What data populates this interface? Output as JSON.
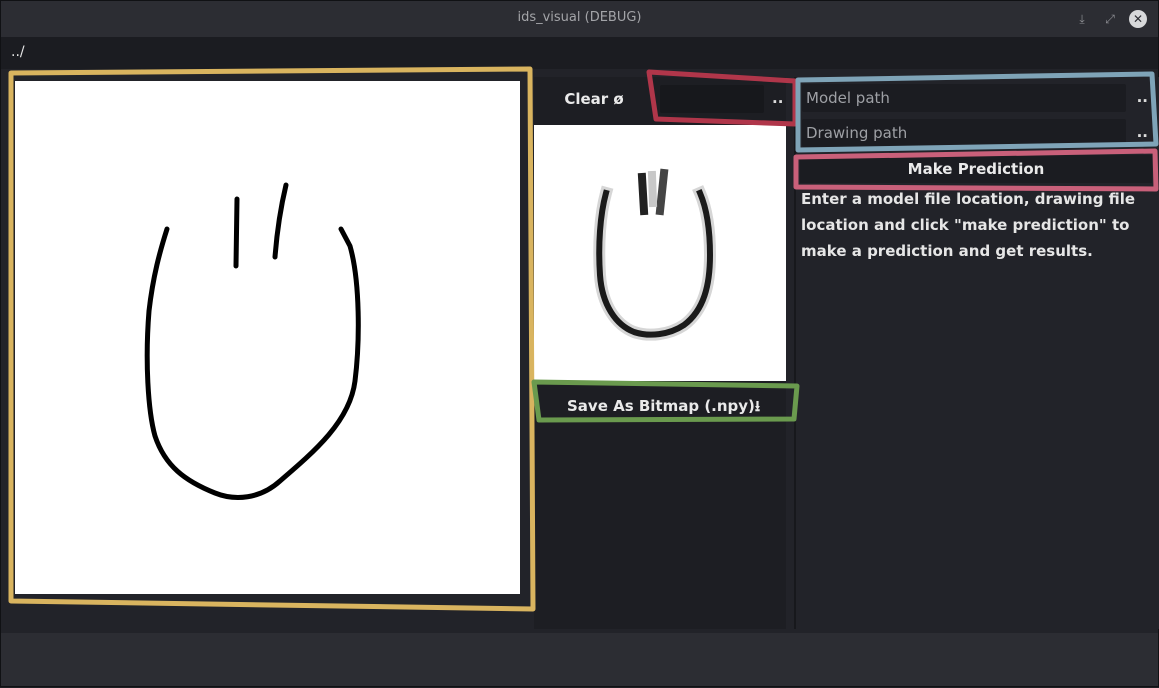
{
  "window": {
    "title": "ids_visual (DEBUG)",
    "controls": {
      "minimize_icon": "⤓",
      "maximize_icon": "⤢",
      "close_icon": "✕"
    }
  },
  "pathbar": {
    "path": "../"
  },
  "drawing_panel": {
    "clear_label": "Clear ø",
    "browse_label": "..",
    "save_label": "Save  As Bitmap (.npy)⭳"
  },
  "prediction_panel": {
    "model_path_placeholder": "Model path",
    "drawing_path_placeholder": "Drawing path",
    "browse_label": "..",
    "predict_label": "Make Prediction",
    "info_text": "Enter a model file location, drawing file location and click \"make prediction\" to make a prediction and get results."
  },
  "colors": {
    "canvas_highlight": "#d9b45f",
    "clear_path_highlight": "#b0364a",
    "paths_highlight": "#7fa4b8",
    "predict_highlight": "#c9607a",
    "save_highlight": "#6a9a4e"
  }
}
